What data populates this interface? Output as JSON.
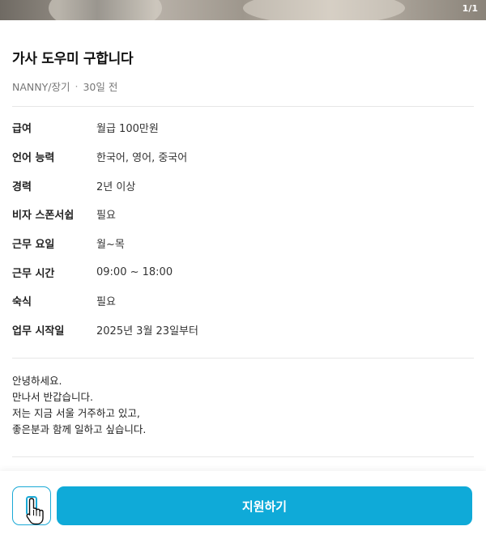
{
  "hero": {
    "counter": "1/1"
  },
  "post": {
    "title": "가사 도우미 구합니다",
    "category": "NANNY/장기",
    "separator": "·",
    "posted": "30일 전"
  },
  "details": [
    {
      "label": "급여",
      "value": "월급 100만원"
    },
    {
      "label": "언어 능력",
      "value": "한국어, 영어, 중국어"
    },
    {
      "label": "경력",
      "value": "2년 이상"
    },
    {
      "label": "비자 스폰서쉽",
      "value": "필요"
    },
    {
      "label": "근무 요일",
      "value": "월~목"
    },
    {
      "label": "근무 시간",
      "value": "09:00 ~ 18:00"
    },
    {
      "label": "숙식",
      "value": "필요"
    },
    {
      "label": "업무 시작일",
      "value": "2025년 3월 23일부터"
    }
  ],
  "description": [
    "안녕하세요.",
    "만나서 반갑습니다.",
    "저는 지금 서울 거주하고 있고,",
    "좋은분과 함께 일하고 싶습니다."
  ],
  "actions": {
    "apply_label": "지원하기",
    "phone_icon": "phone-icon"
  },
  "colors": {
    "accent": "#0faad8",
    "accent_border": "#1aa9d6"
  }
}
